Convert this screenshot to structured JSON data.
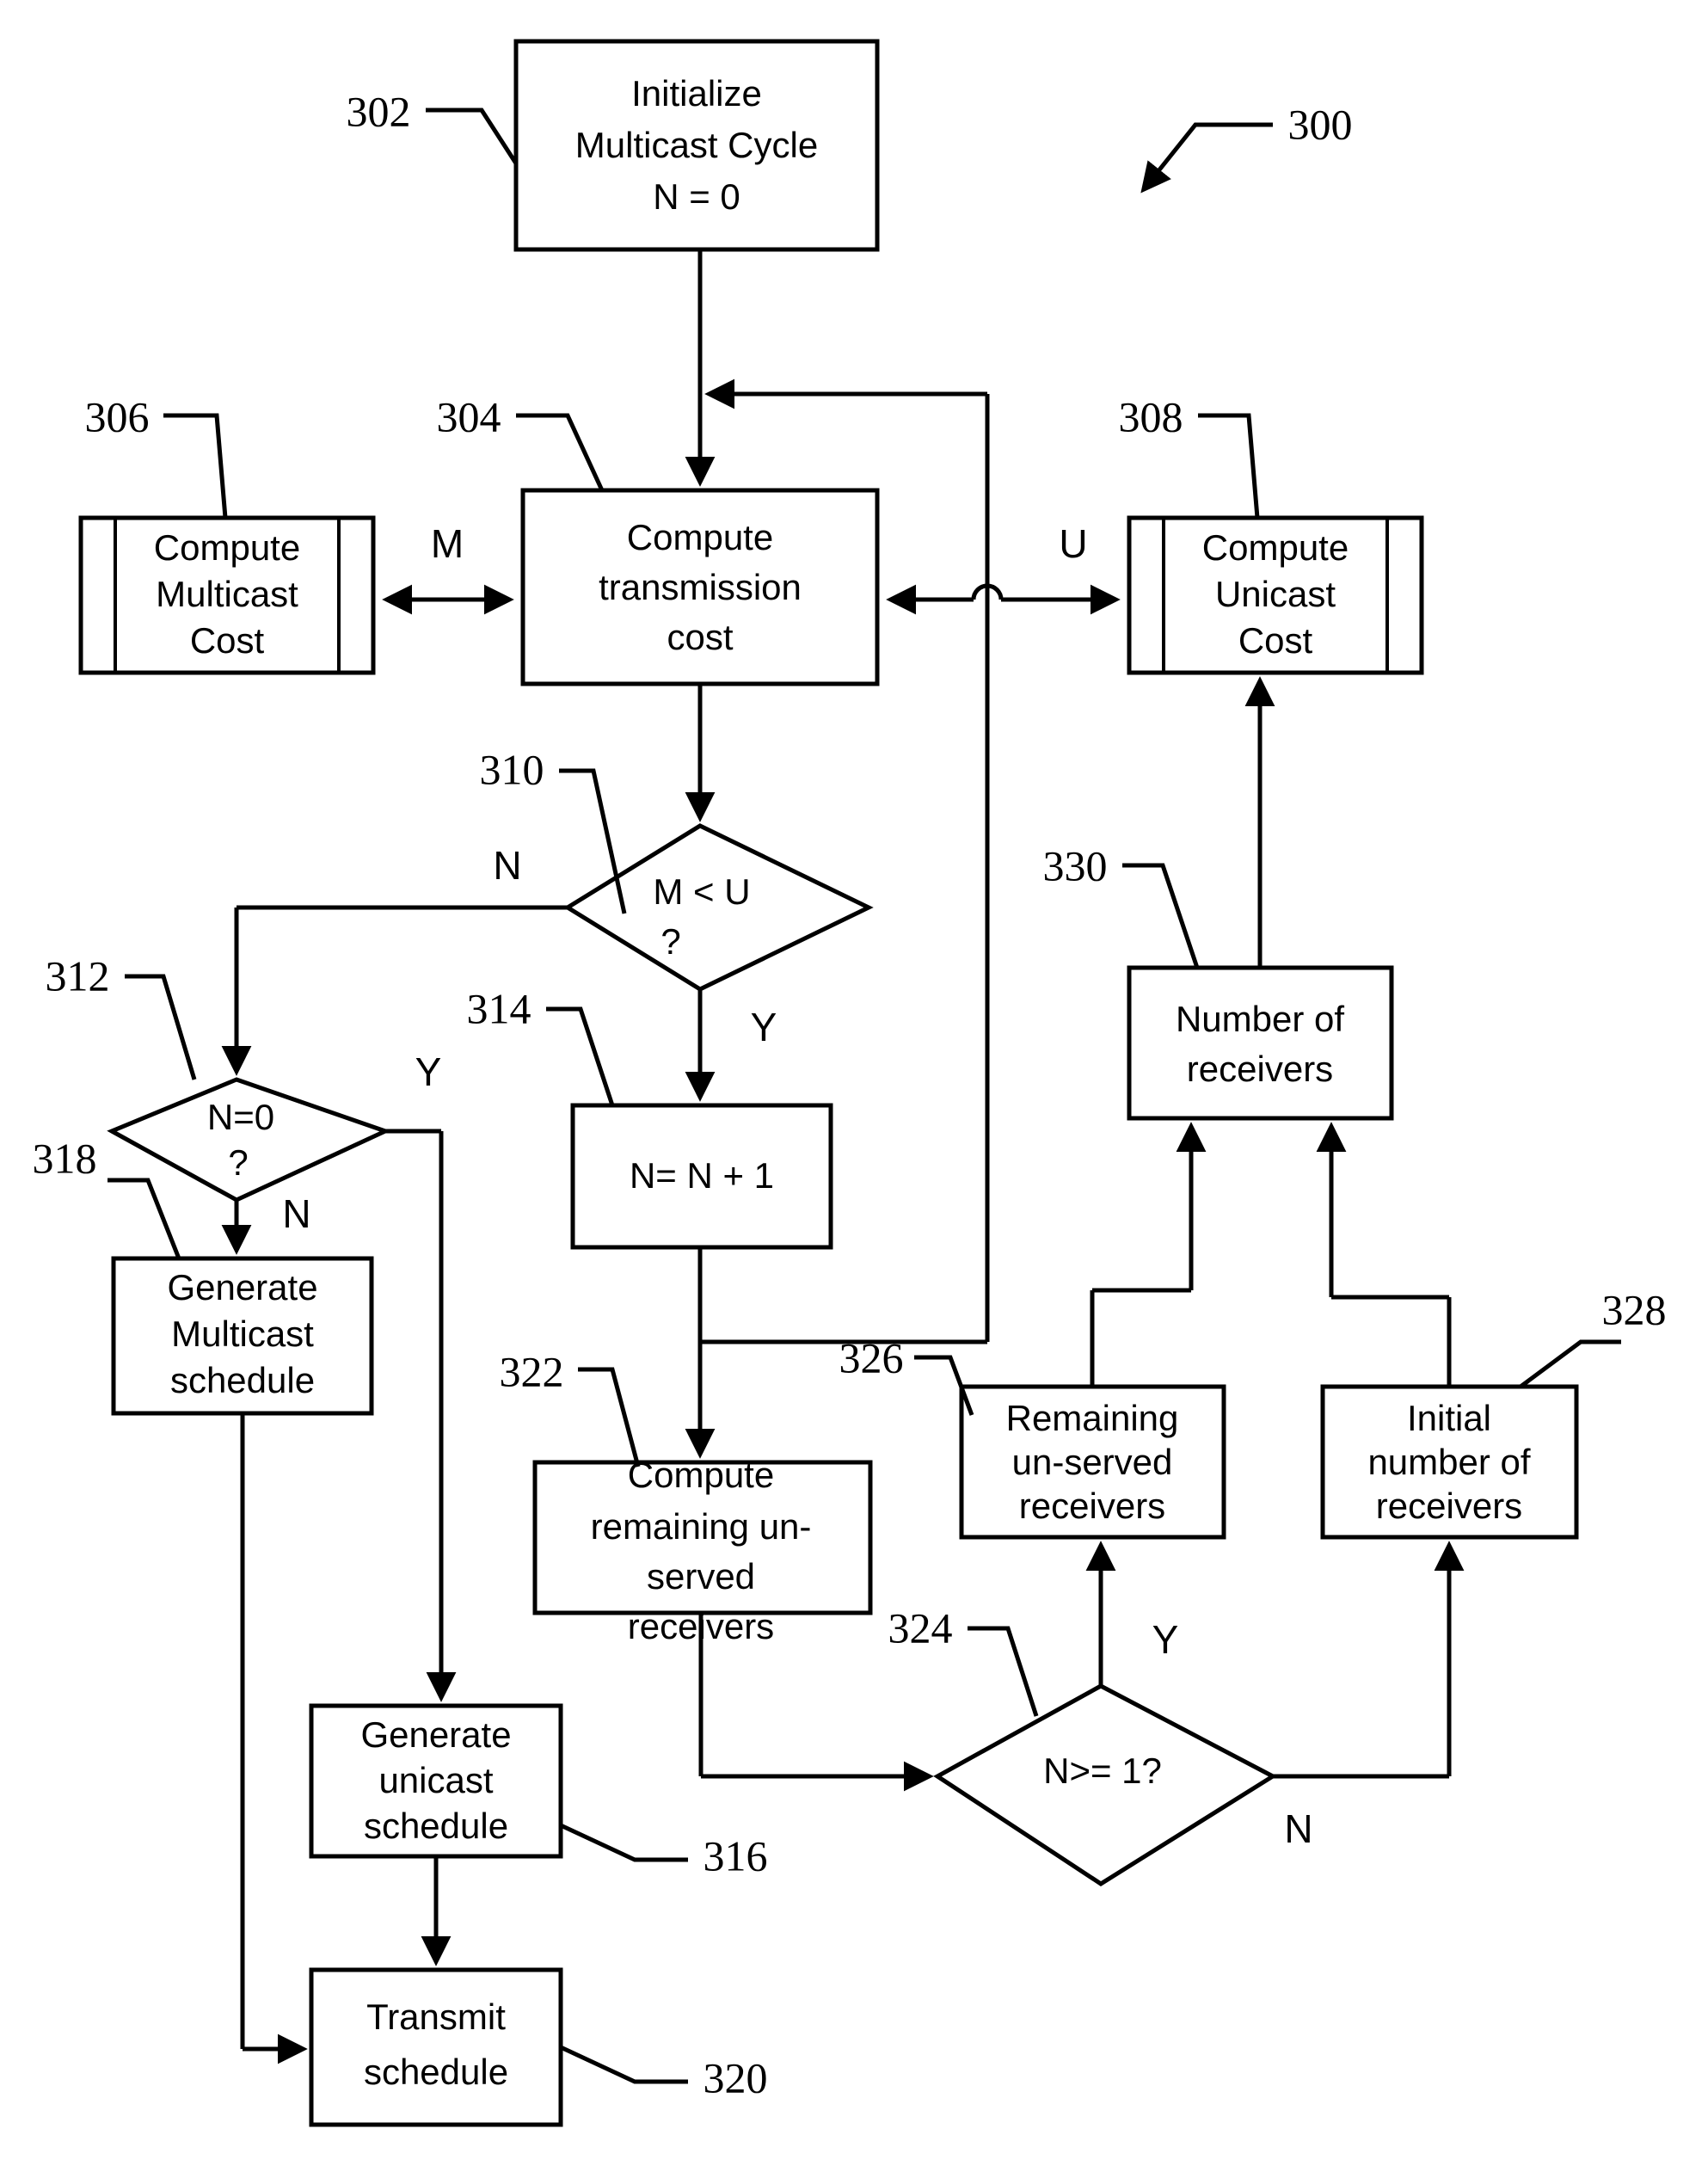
{
  "figure": {
    "figure_number": "300"
  },
  "nodes": {
    "n302": {
      "ref": "302",
      "type": "process",
      "lines": [
        "Initialize",
        "Multicast Cycle",
        "N = 0"
      ]
    },
    "n304": {
      "ref": "304",
      "type": "process",
      "lines": [
        "Compute",
        "transmission",
        "cost"
      ]
    },
    "n306": {
      "ref": "306",
      "type": "subroutine",
      "lines": [
        "Compute",
        "Multicast",
        "Cost"
      ]
    },
    "n308": {
      "ref": "308",
      "type": "subroutine",
      "lines": [
        "Compute",
        "Unicast",
        "Cost"
      ]
    },
    "n310": {
      "ref": "310",
      "type": "decision",
      "lines": [
        "M < U",
        "?"
      ]
    },
    "n312": {
      "ref": "312",
      "type": "decision",
      "lines": [
        "N=0",
        "?"
      ]
    },
    "n314": {
      "ref": "314",
      "type": "process",
      "lines": [
        "N= N + 1"
      ]
    },
    "n316": {
      "ref": "316",
      "type": "process",
      "lines": [
        "Generate",
        "unicast",
        "schedule"
      ]
    },
    "n318": {
      "ref": "318",
      "type": "process",
      "lines": [
        "Generate",
        "Multicast",
        "schedule"
      ]
    },
    "n320": {
      "ref": "320",
      "type": "process",
      "lines": [
        "Transmit",
        "schedule"
      ]
    },
    "n322": {
      "ref": "322",
      "type": "process",
      "lines": [
        "Compute",
        "remaining un-",
        "served",
        "receivers"
      ]
    },
    "n324": {
      "ref": "324",
      "type": "decision",
      "lines": [
        "N>= 1?"
      ]
    },
    "n326": {
      "ref": "326",
      "type": "process",
      "lines": [
        "Remaining",
        "un-served",
        "receivers"
      ]
    },
    "n328": {
      "ref": "328",
      "type": "process",
      "lines": [
        "Initial",
        "number of",
        "receivers"
      ]
    },
    "n330": {
      "ref": "330",
      "type": "process",
      "lines": [
        "Number of",
        "receivers"
      ]
    }
  },
  "edge_labels": {
    "m_cost": "M",
    "u_cost": "U",
    "mlessu_no": "N",
    "mlessu_yes": "Y",
    "neq0_yes": "Y",
    "neq0_no": "N",
    "nge1_yes": "Y",
    "nge1_no": "N"
  },
  "colors": {
    "stroke": "#000000",
    "fill": "#ffffff"
  }
}
